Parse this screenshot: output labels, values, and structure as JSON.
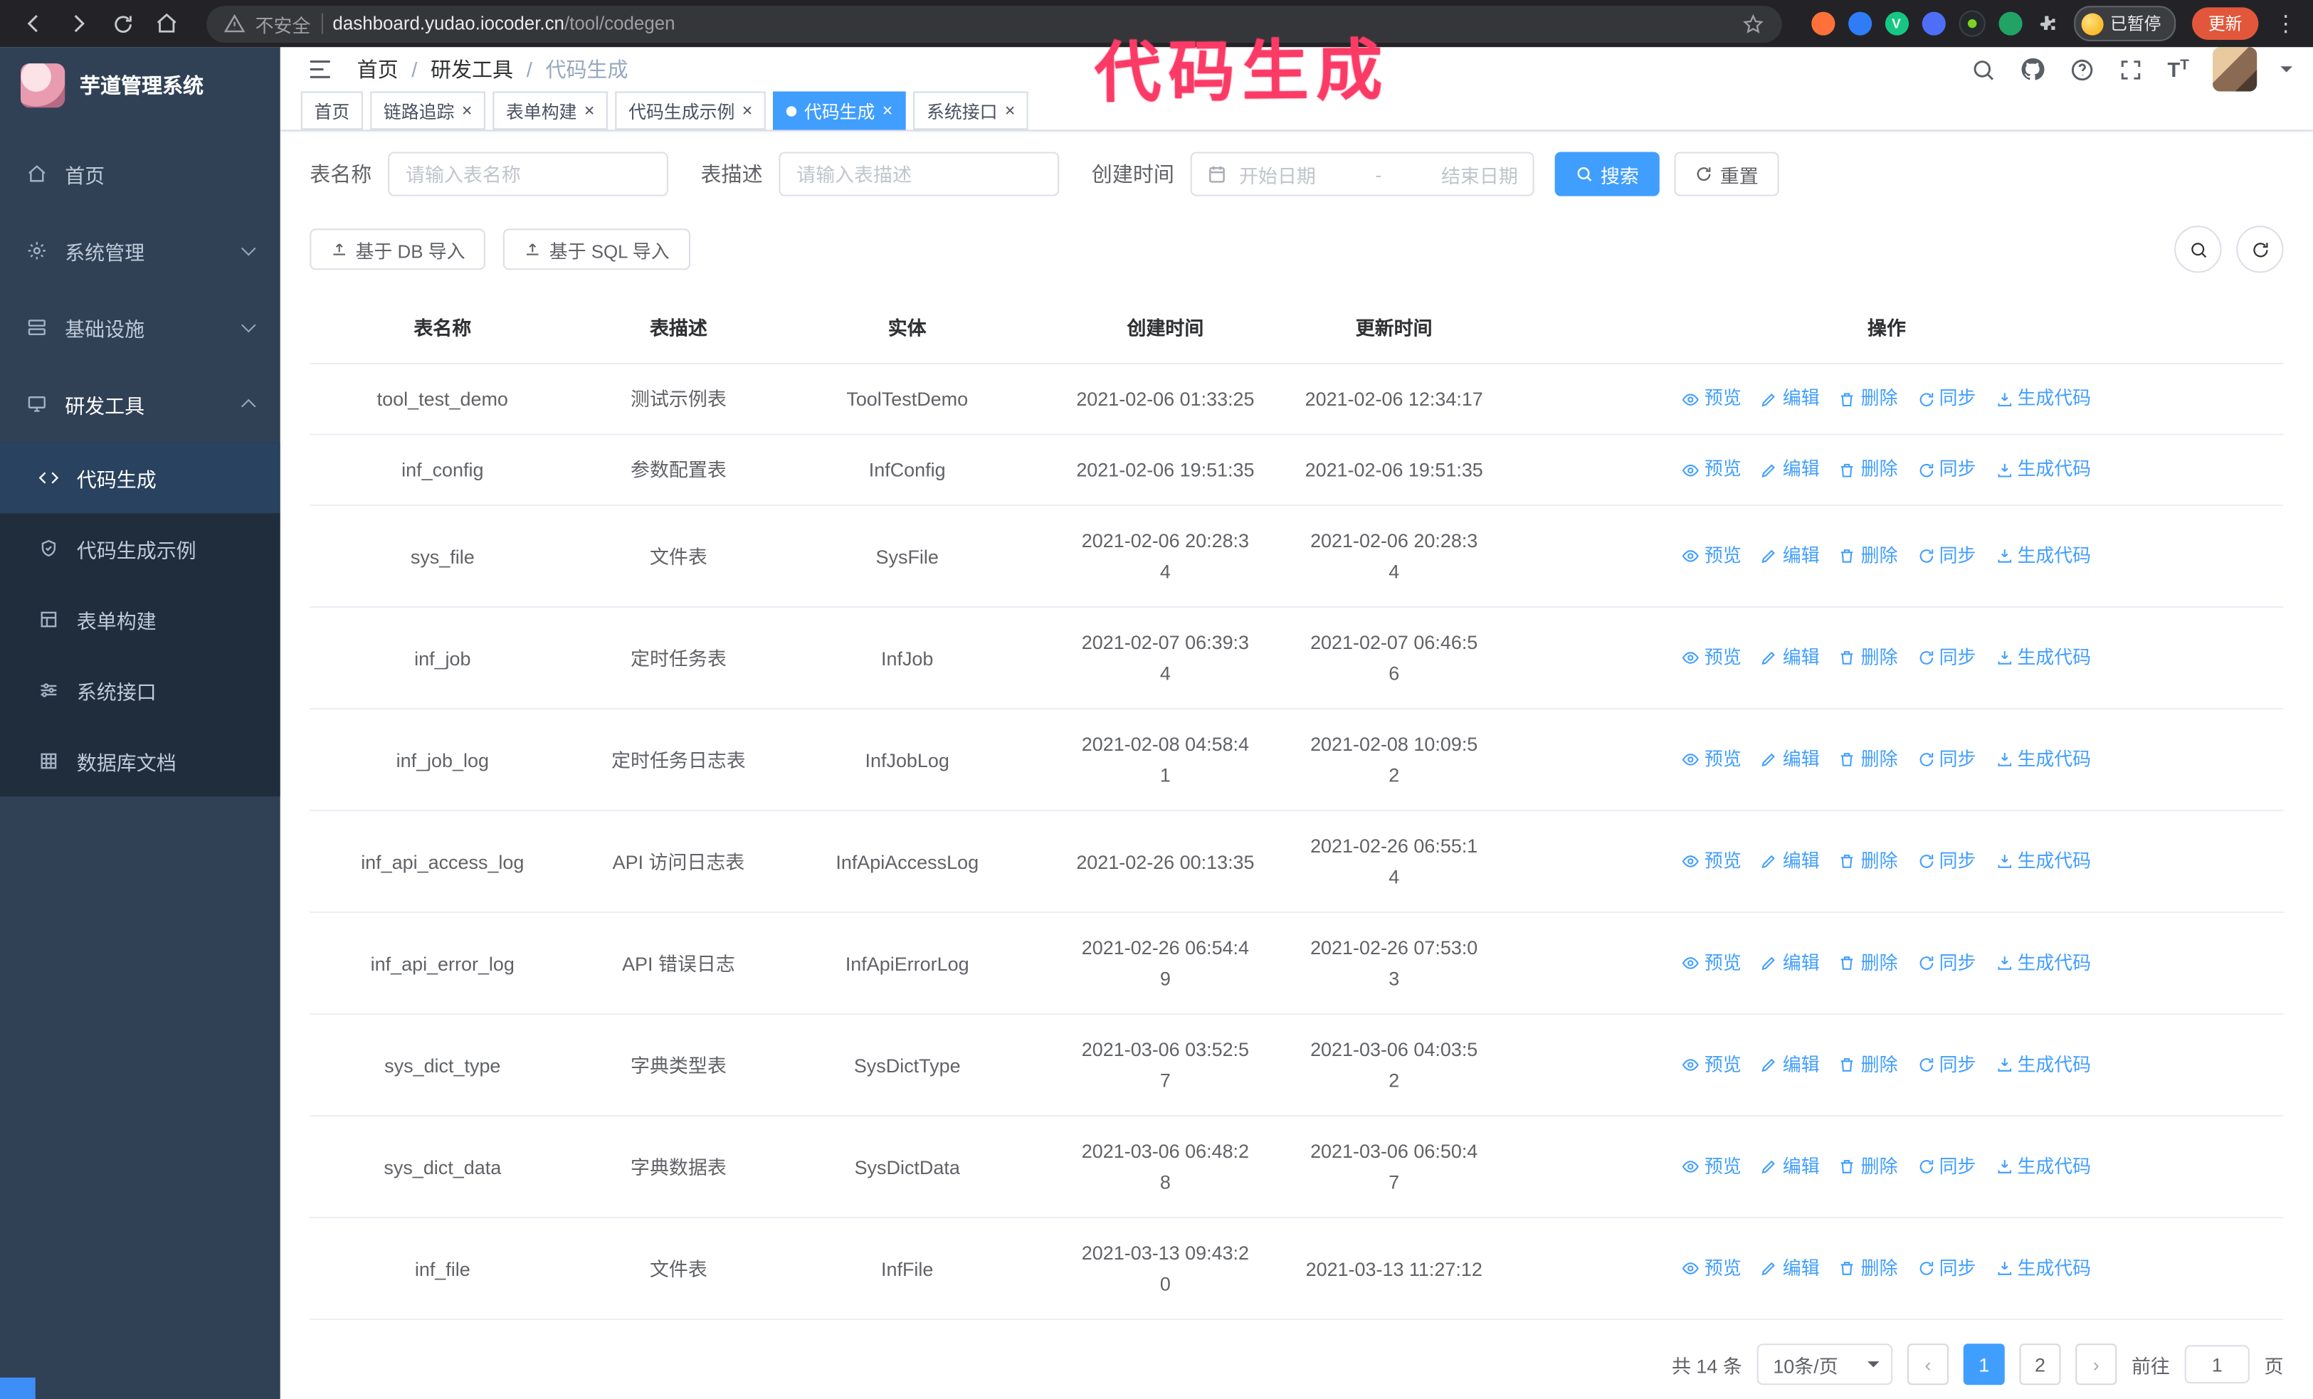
{
  "browser": {
    "security_label": "不安全",
    "url_host": "dashboard.yudao.iocoder.cn",
    "url_path": "/tool/codegen",
    "paused_badge": "已暂停",
    "update_button": "更新"
  },
  "annotation": {
    "text": "代码生成",
    "color": "#fb3b66"
  },
  "sidebar": {
    "logo_title": "芋道管理系统",
    "items": [
      {
        "label": "首页"
      },
      {
        "label": "系统管理"
      },
      {
        "label": "基础设施"
      },
      {
        "label": "研发工具"
      }
    ],
    "subitems": [
      {
        "label": "代码生成"
      },
      {
        "label": "代码生成示例"
      },
      {
        "label": "表单构建"
      },
      {
        "label": "系统接口"
      },
      {
        "label": "数据库文档"
      }
    ]
  },
  "header": {
    "breadcrumb": [
      "首页",
      "研发工具",
      "代码生成"
    ],
    "separator": "/"
  },
  "tabs": [
    {
      "label": "首页"
    },
    {
      "label": "链路追踪"
    },
    {
      "label": "表单构建"
    },
    {
      "label": "代码生成示例"
    },
    {
      "label": "代码生成"
    },
    {
      "label": "系统接口"
    }
  ],
  "filters": {
    "name_label": "表名称",
    "name_placeholder": "请输入表名称",
    "desc_label": "表描述",
    "desc_placeholder": "请输入表描述",
    "time_label": "创建时间",
    "start_placeholder": "开始日期",
    "range_separator": "-",
    "end_placeholder": "结束日期",
    "search_label": "搜索",
    "reset_label": "重置"
  },
  "toolbar": {
    "import_db": "基于 DB 导入",
    "import_sql": "基于 SQL 导入"
  },
  "table": {
    "columns": [
      "表名称",
      "表描述",
      "实体",
      "创建时间",
      "更新时间",
      "操作"
    ],
    "actions": [
      "预览",
      "编辑",
      "删除",
      "同步",
      "生成代码"
    ],
    "rows": [
      {
        "name": "tool_test_demo",
        "desc": "测试示例表",
        "entity": "ToolTestDemo",
        "create": "2021-02-06 01:33:25",
        "update": "2021-02-06 12:34:17"
      },
      {
        "name": "inf_config",
        "desc": "参数配置表",
        "entity": "InfConfig",
        "create": "2021-02-06 19:51:35",
        "update": "2021-02-06 19:51:35"
      },
      {
        "name": "sys_file",
        "desc": "文件表",
        "entity": "SysFile",
        "create": "2021-02-06 20:28:3\n4",
        "update": "2021-02-06 20:28:3\n4"
      },
      {
        "name": "inf_job",
        "desc": "定时任务表",
        "entity": "InfJob",
        "create": "2021-02-07 06:39:3\n4",
        "update": "2021-02-07 06:46:5\n6"
      },
      {
        "name": "inf_job_log",
        "desc": "定时任务日志表",
        "entity": "InfJobLog",
        "create": "2021-02-08 04:58:4\n1",
        "update": "2021-02-08 10:09:5\n2"
      },
      {
        "name": "inf_api_access_log",
        "desc": "API 访问日志表",
        "entity": "InfApiAccessLog",
        "create": "2021-02-26 00:13:35",
        "update": "2021-02-26 06:55:1\n4"
      },
      {
        "name": "inf_api_error_log",
        "desc": "API 错误日志",
        "entity": "InfApiErrorLog",
        "create": "2021-02-26 06:54:4\n9",
        "update": "2021-02-26 07:53:0\n3"
      },
      {
        "name": "sys_dict_type",
        "desc": "字典类型表",
        "entity": "SysDictType",
        "create": "2021-03-06 03:52:5\n7",
        "update": "2021-03-06 04:03:5\n2"
      },
      {
        "name": "sys_dict_data",
        "desc": "字典数据表",
        "entity": "SysDictData",
        "create": "2021-03-06 06:48:2\n8",
        "update": "2021-03-06 06:50:4\n7"
      },
      {
        "name": "inf_file",
        "desc": "文件表",
        "entity": "InfFile",
        "create": "2021-03-13 09:43:2\n0",
        "update": "2021-03-13 11:27:12"
      }
    ]
  },
  "pagination": {
    "total": "共 14 条",
    "page_size": "10条/页",
    "pages": [
      "1",
      "2"
    ],
    "goto_label": "前往",
    "goto_value": "1",
    "goto_suffix": "页"
  }
}
